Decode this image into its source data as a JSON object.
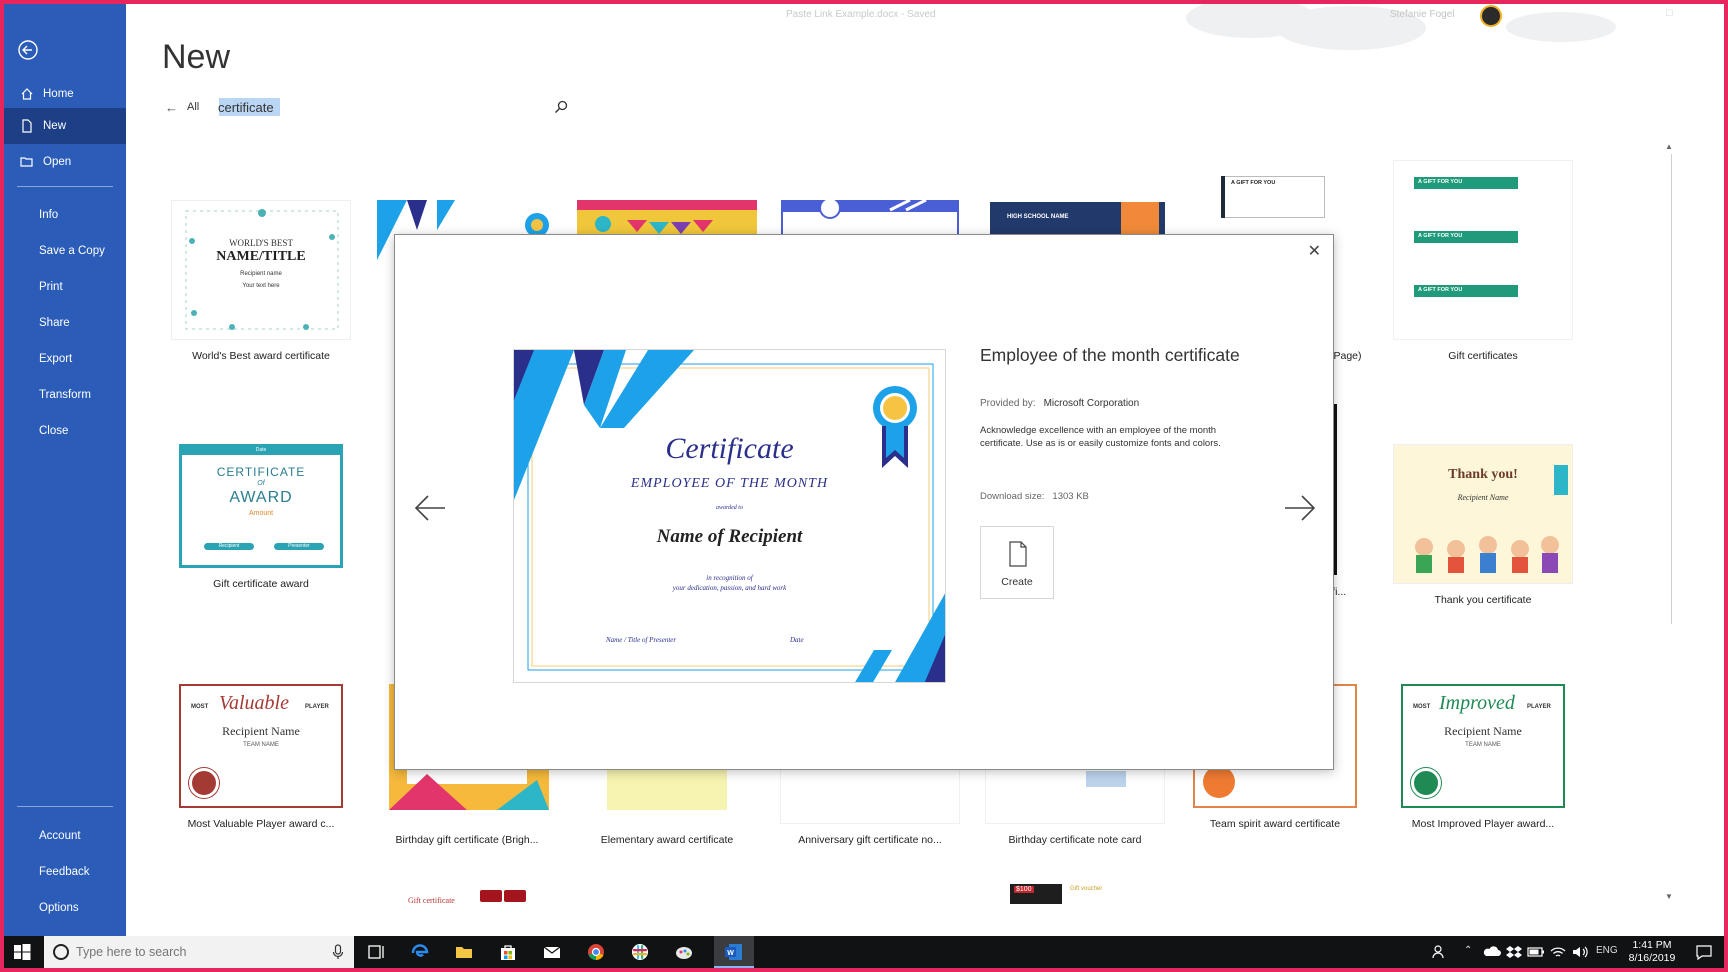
{
  "window": {
    "doc_title": "Paste Link Example.docx - Saved",
    "user_name": "Stefanie Fogel"
  },
  "sidebar": {
    "items": [
      {
        "label": "Home",
        "icon": "home-icon"
      },
      {
        "label": "New",
        "icon": "new-document-icon",
        "active": true
      },
      {
        "label": "Open",
        "icon": "folder-open-icon"
      },
      {
        "label": "Info"
      },
      {
        "label": "Save a Copy"
      },
      {
        "label": "Print"
      },
      {
        "label": "Share"
      },
      {
        "label": "Export"
      },
      {
        "label": "Transform"
      },
      {
        "label": "Close"
      }
    ],
    "bottom": [
      "Account",
      "Feedback",
      "Options"
    ]
  },
  "page": {
    "title": "New",
    "breadcrumb_all": "All",
    "search_value": "certificate"
  },
  "templates": {
    "row1": [
      {
        "caption": "World's Best award certificate",
        "thumb_title": "WORLD'S BEST",
        "thumb_main": "NAME/TITLE",
        "thumb_sub1": "Recipient name",
        "thumb_sub2": "Your text here"
      },
      {
        "caption": "Employee of the month certificate"
      },
      {
        "caption": ""
      },
      {
        "caption": ""
      },
      {
        "caption": "",
        "thumb_text": "HIGH SCHOOL NAME"
      },
      {
        "caption": "(Page)",
        "thumb_text": "A GIFT FOR YOU"
      },
      {
        "caption": "Gift certificates",
        "thumb_text": "A GIFT FOR YOU"
      }
    ],
    "row2": [
      {
        "caption": "Gift certificate award",
        "thumb_top": "Date",
        "thumb_l1": "CERTIFICATE",
        "thumb_l2": "Of",
        "thumb_l3": "AWARD",
        "thumb_l4": "Amount",
        "thumb_b1": "Recipient",
        "thumb_b2": "Presenter"
      },
      {
        "caption": "Certifi..."
      },
      {
        "caption": "Thank you certificate",
        "thumb_l1": "Thank you!",
        "thumb_l2": "Recipient Name"
      }
    ],
    "row3": [
      {
        "caption": "Most Valuable Player award c...",
        "thumb_script": "Valuable",
        "thumb_most": "MOST",
        "thumb_player": "PLAYER",
        "thumb_name": "Recipient Name",
        "thumb_team": "TEAM NAME"
      },
      {
        "caption": "Birthday gift certificate (Brigh..."
      },
      {
        "caption": "Elementary award certificate"
      },
      {
        "caption": "Anniversary gift certificate no..."
      },
      {
        "caption": "Birthday certificate note card"
      },
      {
        "caption": "Team spirit award certificate"
      },
      {
        "caption": "Most Improved Player award...",
        "thumb_script": "Improved",
        "thumb_most": "MOST",
        "thumb_player": "PLAYER",
        "thumb_name": "Recipient Name",
        "thumb_team": "TEAM NAME"
      }
    ],
    "row4": [
      {
        "thumb_text": "Gift certificate"
      },
      {
        "thumb_text": "$100",
        "thumb_text2": "Gift voucher"
      }
    ]
  },
  "modal": {
    "title": "Employee of the month certificate",
    "provided_label": "Provided by:",
    "provided_value": "Microsoft Corporation",
    "description": "Acknowledge excellence with an employee of the month certificate. Use as is or easily customize fonts and colors.",
    "size_label": "Download size:",
    "size_value": "1303 KB",
    "create_label": "Create",
    "preview": {
      "heading": "Certificate",
      "subheading": "EMPLOYEE OF THE MONTH",
      "awarded_to": "awarded to",
      "recipient": "Name of Recipient",
      "recognition1": "in recognition of",
      "recognition2": "your dedication, passion, and hard work",
      "presenter": "Name / Title of Presenter",
      "date": "Date"
    }
  },
  "taskbar": {
    "search_placeholder": "Type here to search",
    "lang": "ENG",
    "time": "1:41 PM",
    "date": "8/16/2019"
  },
  "colors": {
    "sidebar": "#2a5cb8",
    "sidebar_active": "#1c3f86",
    "cert_blue": "#1da1e8",
    "cert_navy": "#2a2f8c",
    "frame": "#e8265e"
  }
}
